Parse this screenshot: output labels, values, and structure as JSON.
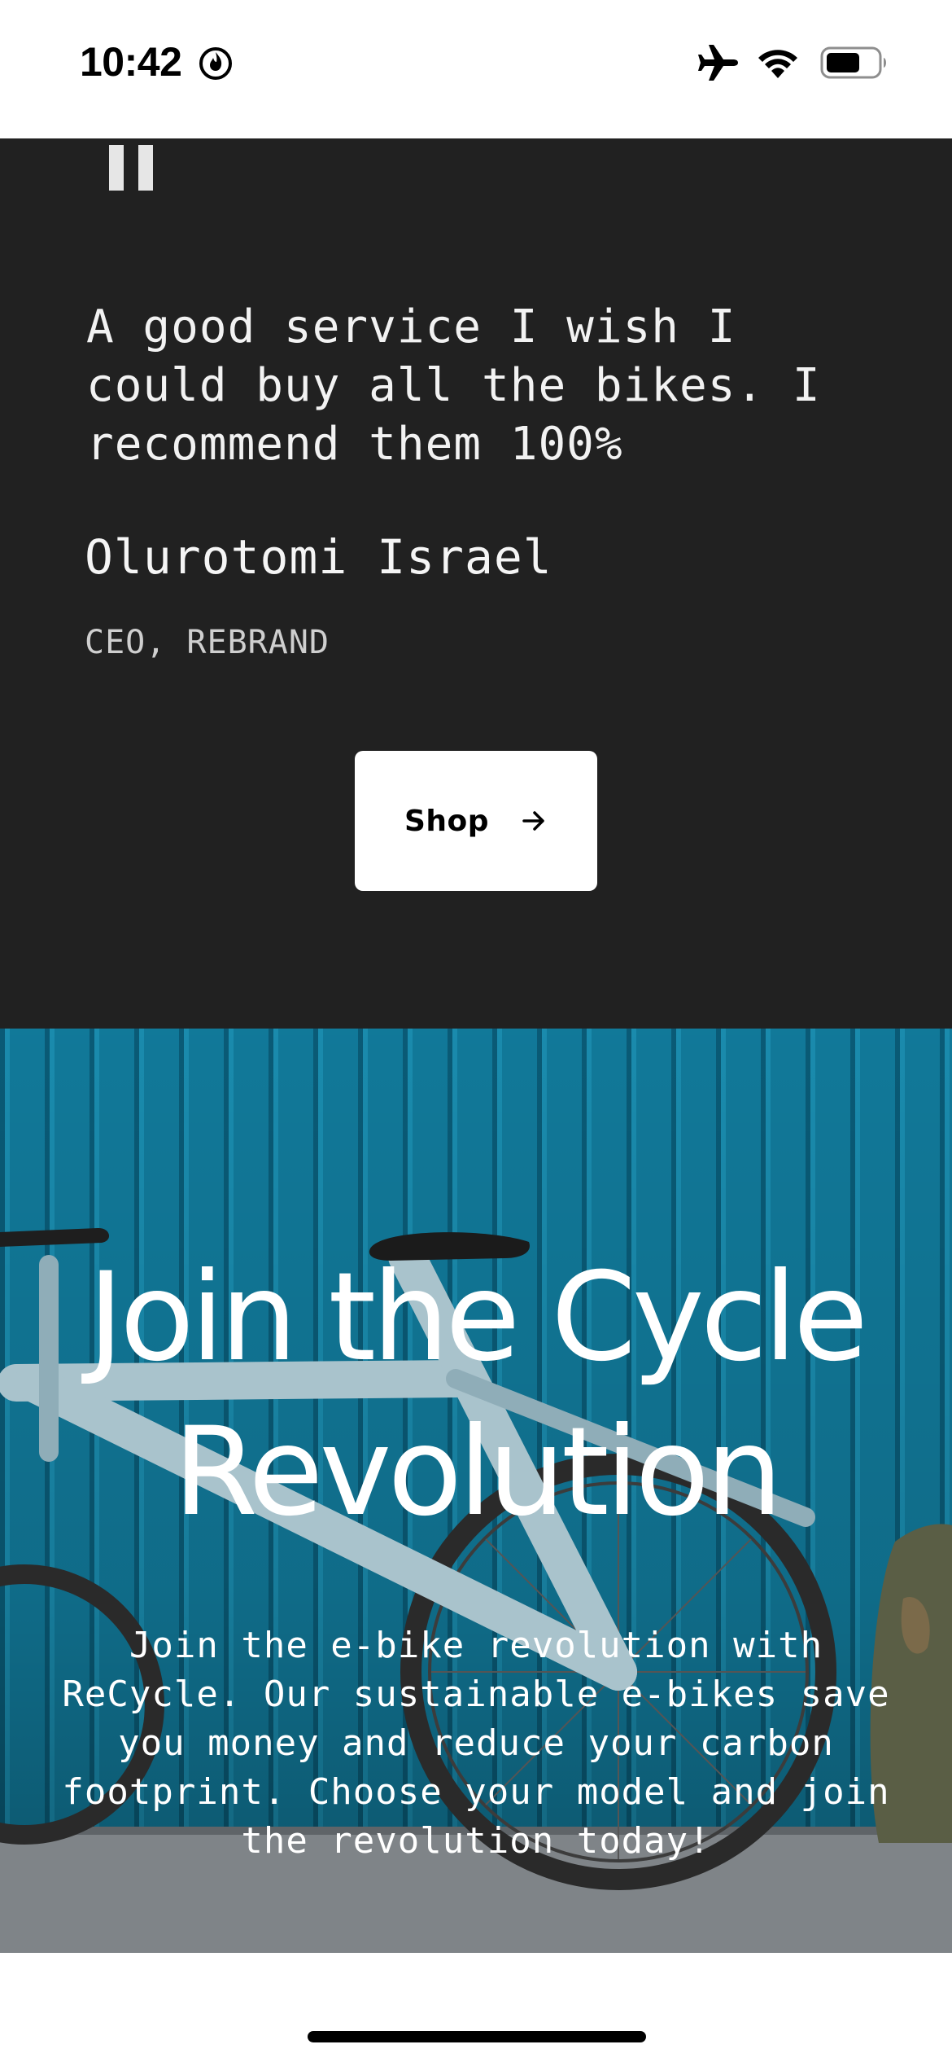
{
  "status_bar": {
    "time": "10:42",
    "icons": [
      "focus-flame-icon",
      "airplane-icon",
      "wifi-icon",
      "battery-icon"
    ]
  },
  "testimonial": {
    "quote": "A good service I wish I could buy all the bikes. I recommend them 100%",
    "author": "Olurotomi Israel",
    "role": "CEO, REBRAND",
    "shop_button_label": "Shop",
    "background": "#212121"
  },
  "hero": {
    "title": "Join the Cycle Revolution",
    "body": "Join the e-bike revolution with ReCycle. Our sustainable e-bikes save you money and reduce your carbon footprint. Choose your model and join the revolution today!",
    "background_accent": "#0f7ea0"
  }
}
